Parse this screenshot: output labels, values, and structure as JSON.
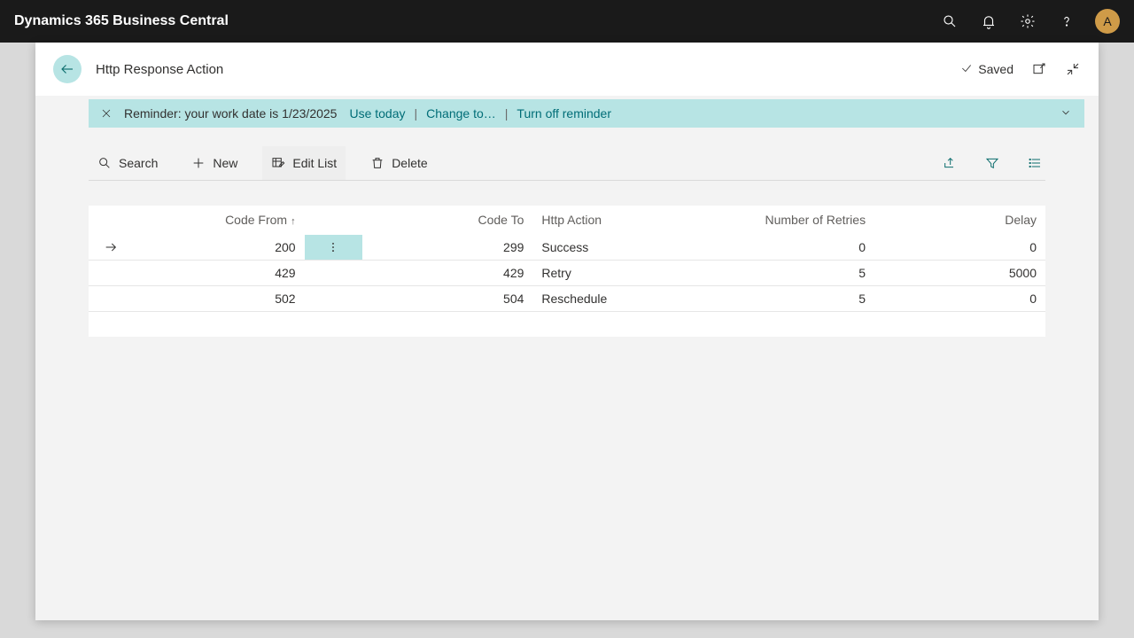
{
  "app": {
    "brand": "Dynamics 365 Business Central",
    "avatar_initial": "A"
  },
  "page": {
    "title": "Http Response Action",
    "saved_label": "Saved"
  },
  "reminder": {
    "message": "Reminder: your work date is 1/23/2025",
    "use_today": "Use today",
    "change_to": "Change to…",
    "turn_off": "Turn off reminder"
  },
  "toolbar": {
    "search": "Search",
    "new_": "New",
    "edit_list": "Edit List",
    "delete": "Delete"
  },
  "grid": {
    "columns": {
      "code_from": "Code From",
      "code_to": "Code To",
      "http_action": "Http Action",
      "retries": "Number of Retries",
      "delay": "Delay"
    },
    "sort": {
      "column": "code_from",
      "direction": "asc"
    },
    "rows": [
      {
        "code_from": "200",
        "code_to": "299",
        "http_action": "Success",
        "retries": "0",
        "delay": "0",
        "selected": true
      },
      {
        "code_from": "429",
        "code_to": "429",
        "http_action": "Retry",
        "retries": "5",
        "delay": "5000",
        "selected": false
      },
      {
        "code_from": "502",
        "code_to": "504",
        "http_action": "Reschedule",
        "retries": "5",
        "delay": "0",
        "selected": false
      }
    ]
  }
}
